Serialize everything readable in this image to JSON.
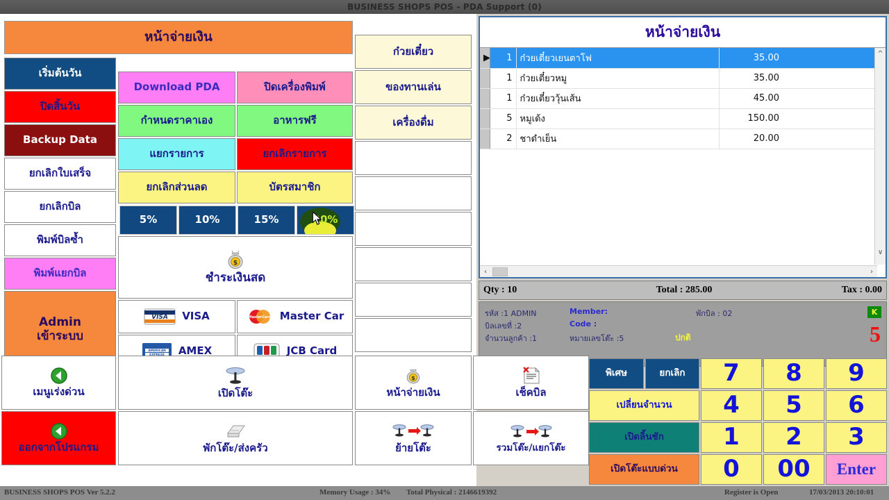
{
  "window": {
    "title": "BUSINESS SHOPS POS - PDA Support (0)"
  },
  "left_panel": {
    "header": "หน้าจ่ายเงิน",
    "column1": [
      {
        "label": "เริ่มต้นวัน",
        "color": "navy"
      },
      {
        "label": "ปิดสิ้นวัน",
        "color": "red"
      },
      {
        "label": "Backup Data",
        "color": "darkred"
      },
      {
        "label": "ยกเลิกใบเสร็จ",
        "color": "white"
      },
      {
        "label": "ยกเลิกบิล",
        "color": "white"
      },
      {
        "label": "พิมพ์บิลซ้ำ",
        "color": "white"
      },
      {
        "label": "พิมพ์แยกบิล",
        "color": "magenta"
      },
      {
        "label": "Admin",
        "label2": "เข้าระบบ",
        "color": "orange"
      }
    ],
    "row_pairs": [
      {
        "left": "Download PDA",
        "left_color": "magenta",
        "right": "ปิดเครื่องพิมพ์",
        "right_color": "pink"
      },
      {
        "left": "กำหนดราคาเอง",
        "left_color": "green",
        "right": "อาหารฟรี",
        "right_color": "green"
      },
      {
        "left": "แยกรายการ",
        "left_color": "cyan",
        "right": "ยกเลิกรายการ",
        "right_color": "red"
      },
      {
        "left": "ยกเลิกส่วนลด",
        "left_color": "yellow",
        "right": "บัตรสมาชิก",
        "right_color": "yellow"
      }
    ],
    "discounts": [
      {
        "label": "5%",
        "active": false
      },
      {
        "label": "10%",
        "active": false
      },
      {
        "label": "15%",
        "active": false
      },
      {
        "label": "20%",
        "active": true
      }
    ],
    "cash_button": {
      "label": "ชำระเงินสด",
      "icon": "money-bag-icon"
    },
    "cards": [
      {
        "label": "VISA",
        "icon": "visa-logo"
      },
      {
        "label": "Master Car",
        "icon": "mastercard-logo"
      },
      {
        "label": "AMEX",
        "icon": "amex-logo"
      },
      {
        "label": "JCB Card",
        "icon": "jcb-logo"
      }
    ],
    "categories": [
      {
        "label": "ก๋วยเตี๋ยว"
      },
      {
        "label": "ของทานเล่น"
      },
      {
        "label": "เครื่องดื่ม"
      },
      {
        "label": ""
      },
      {
        "label": ""
      },
      {
        "label": ""
      },
      {
        "label": ""
      }
    ]
  },
  "bottom_actions": [
    {
      "label": "เมนูเร่งด่วน",
      "icon": "back-arrow-icon",
      "color": "white"
    },
    {
      "label": "เปิดโต๊ะ",
      "icon": "table-icon",
      "color": "white"
    },
    {
      "label": "หน้าจ่ายเงิน",
      "icon": "money-bag-icon",
      "color": "white"
    },
    {
      "label": "เช็คบิล",
      "icon": "bill-icon",
      "color": "white"
    },
    {
      "label": "ออกจากโปรแกรม",
      "icon": "back-arrow-icon",
      "color": "red"
    },
    {
      "label": "พักโต๊ะ/ส่งครัว",
      "icon": "printer-icon",
      "color": "white"
    },
    {
      "label": "ย้ายโต๊ะ",
      "icon": "move-table-icon",
      "color": "white"
    },
    {
      "label": "รวมโต๊ะ/แยกโต๊ะ",
      "icon": "merge-table-icon",
      "color": "white"
    }
  ],
  "right_panel": {
    "grid_title": "หน้าจ่ายเงิน",
    "order_rows": [
      {
        "qty": "1",
        "name": "ก๋วยเตี๋ยวเยนตาโฟ",
        "price": "35.00",
        "extra": "",
        "selected": true
      },
      {
        "qty": "1",
        "name": "ก๋วยเตี๋ยวหมู",
        "price": "35.00",
        "extra": "",
        "selected": false
      },
      {
        "qty": "1",
        "name": "ก๋วยเตี๋ยววุ้นเส้น",
        "price": "45.00",
        "extra": "",
        "selected": false
      },
      {
        "qty": "5",
        "name": "หมูเด้ง",
        "price": "150.00",
        "extra": "",
        "selected": false
      },
      {
        "qty": "2",
        "name": "ชาดำเย็น",
        "price": "20.00",
        "extra": "",
        "selected": false
      }
    ],
    "totals": {
      "qty": "Qty : 10",
      "total": "Total :  285.00",
      "tax": "Tax :  0.00"
    },
    "info": {
      "code_label": "รหัส",
      "code_value": ":1 ADMIN",
      "bill_no_label": "บิลเลขที่",
      "bill_no_value": ":2",
      "customers_label": "จำนวนลูกค้า",
      "customers_value": ":1",
      "member_label": "Member:",
      "code2_label": "Code :",
      "table_no_label": "หมายเลขโต๊ะ",
      "table_no_value": ":5",
      "hold_bill_label": "พักบิล",
      "hold_bill_value": ": 02",
      "status_text": "ปกติ",
      "badge": "K",
      "big_number": "5"
    },
    "keypad_left": [
      {
        "label": "พิเศษ",
        "color": "navy"
      },
      {
        "label": "ยกเลิก",
        "color": "navy"
      },
      {
        "label": "เปลี่ยนจำนวน",
        "color": "keyyel"
      },
      {
        "label": "เปิดลิ้นชัก",
        "color": "teal"
      },
      {
        "label": "เปิดโต๊ะแบบด่วน",
        "color": "orange"
      }
    ],
    "keypad_numbers": [
      {
        "label": "7",
        "color": "keyyel"
      },
      {
        "label": "8",
        "color": "keyyel"
      },
      {
        "label": "9",
        "color": "keyyel"
      },
      {
        "label": "4",
        "color": "keyyel"
      },
      {
        "label": "5",
        "color": "keyyel"
      },
      {
        "label": "6",
        "color": "keyyel"
      },
      {
        "label": "1",
        "color": "keyyel"
      },
      {
        "label": "2",
        "color": "keyyel"
      },
      {
        "label": "3",
        "color": "keyyel"
      },
      {
        "label": "0",
        "color": "keyyel"
      },
      {
        "label": "00",
        "color": "keyyel"
      },
      {
        "label": "Enter",
        "color": "enter"
      }
    ]
  },
  "statusbar": {
    "app": "BUSINESS SHOPS POS Ver 5.2.2",
    "memory": "Memory Usage : 34%",
    "physical": "Total Physical : 2146619392",
    "register": "Register is Open",
    "datetime": "17/03/2013 20:10:01"
  },
  "colors": {
    "accent_orange": "#f5883c",
    "navy": "#114d82",
    "red": "#fe0000",
    "select_blue": "#2a93f0",
    "keypad_yellow": "#fbf483"
  }
}
